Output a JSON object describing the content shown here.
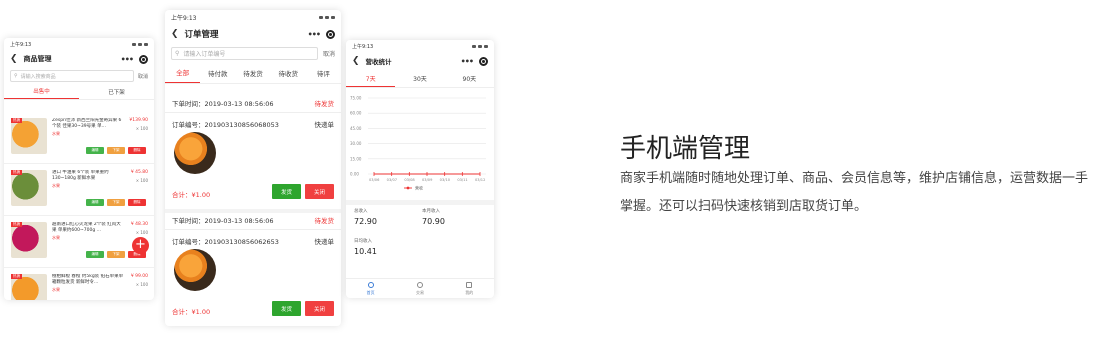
{
  "status_time": "上午9:13",
  "products_screen": {
    "title": "商品管理",
    "search_placeholder": "请输入搜索商品",
    "search_cancel": "取消",
    "tabs": [
      "出售中",
      "已下架"
    ],
    "items": [
      {
        "tag": "热销",
        "name": "Zespri佳沛 新西兰阳光金奇异果 6个装 佳果30~39号果 单...",
        "price": "¥139.90",
        "stock": "× 100",
        "spec": "水果"
      },
      {
        "tag": "热销",
        "name": "进口 牛油果 6个装 单果重约130~180g 新鲜水果",
        "price": "¥ 45.80",
        "stock": "× 100",
        "spec": "水果"
      },
      {
        "tag": "热销",
        "name": "越南进口红心火龙果 2个装 红肉大果 单果约600~700g ...",
        "price": "¥ 48.30",
        "stock": "× 100",
        "spec": "水果"
      },
      {
        "tag": "热销",
        "name": "椪柑鲜橙 春橙 约5kg装 铂石单果单箱颗粒发货 新鲜时令...",
        "price": "¥ 99.00",
        "stock": "× 100",
        "spec": "水果"
      }
    ],
    "op_labels": {
      "edit": "编辑",
      "off": "下架",
      "del": "删除"
    },
    "thumb_colors": [
      "#f4a234",
      "#6b8e3a",
      "#c2185b",
      "#f39a2a"
    ]
  },
  "orders_screen": {
    "title": "订单管理",
    "search_placeholder": "请输入订单编号",
    "search_cancel": "取消",
    "tabs": [
      "全部",
      "待付款",
      "待发货",
      "待收货",
      "待评"
    ],
    "orders": [
      {
        "time": "下单时间：2019-03-13 08:56:06",
        "status": "待发货",
        "number": "订单编号：201903130856068053",
        "ship_type": "快递单",
        "total": "合计：¥1.00",
        "btn_ship": "发货",
        "btn_close": "关闭"
      },
      {
        "time": "下单时间：2019-03-13 08:56:06",
        "status": "待发货",
        "number": "订单编号：201903130856062653",
        "ship_type": "快递单",
        "total": "合计：¥1.00",
        "btn_ship": "发货",
        "btn_close": "关闭"
      }
    ]
  },
  "revenue_screen": {
    "title": "营收统计",
    "tabs": [
      "7天",
      "30天",
      "90天"
    ],
    "chart_data": {
      "type": "line",
      "x": [
        "03/06",
        "03/07",
        "03/08",
        "03/09",
        "03/10",
        "03/11",
        "03/12"
      ],
      "series": [
        {
          "name": "营收",
          "values": [
            0,
            0,
            0,
            0,
            0,
            0,
            0
          ]
        }
      ],
      "yticks": [
        "75.00",
        "60.00",
        "45.00",
        "30.00",
        "15.00",
        "0.00"
      ],
      "ylim": [
        0,
        75
      ],
      "grid": true,
      "legend": "bottom",
      "color": "#e33"
    },
    "stats": [
      {
        "label": "总收入",
        "value": "72.90"
      },
      {
        "label": "本月收入",
        "value": "70.90"
      },
      {
        "label": "日均收入",
        "value": "10.41"
      }
    ],
    "bottom_nav": [
      "首页",
      "交易",
      "我的"
    ]
  },
  "headline": "手机端管理",
  "description": "商家手机端随时随地处理订单、商品、会员信息等，维护店铺信息，运营数据一手掌握。还可以扫码快速核销到店取货订单。"
}
